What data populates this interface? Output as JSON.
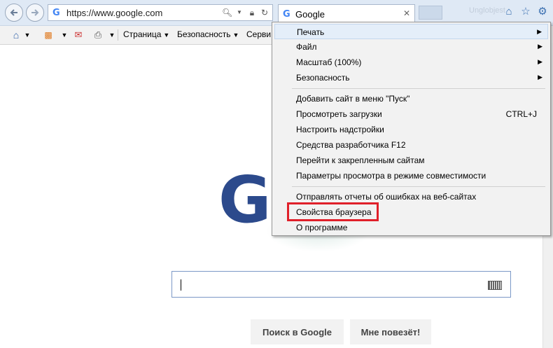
{
  "browser": {
    "address_url": "https://www.google.com",
    "tab_title": "Google",
    "tab_favicon": "G",
    "address_favicon": "G",
    "ghost_label": "Unglobjest"
  },
  "command_bar": {
    "page_label": "Страница",
    "security_label": "Безопасность",
    "service_label": "Серви"
  },
  "menu": {
    "items": [
      {
        "label": "Печать",
        "has_submenu": true
      },
      {
        "label": "Файл",
        "has_submenu": true
      },
      {
        "label": "Масштаб (100%)",
        "has_submenu": true
      },
      {
        "label": "Безопасность",
        "has_submenu": true
      },
      {
        "label": "Добавить сайт в меню \"Пуск\""
      },
      {
        "label": "Просмотреть загрузки",
        "shortcut": "CTRL+J"
      },
      {
        "label": "Настроить надстройки"
      },
      {
        "label": "Средства разработчика F12"
      },
      {
        "label": "Перейти к закрепленным сайтам"
      },
      {
        "label": "Параметры просмотра в режиме совместимости"
      },
      {
        "label": "Отправлять отчеты об ошибках на веб-сайтах"
      },
      {
        "label": "Свойства браузера"
      },
      {
        "label": "О программе"
      }
    ]
  },
  "google": {
    "logo_visible": "G",
    "search_button": "Поиск в Google",
    "lucky_button": "Мне повезёт!"
  },
  "icons": [
    "back-arrow-icon",
    "forward-arrow-icon",
    "search-icon",
    "lock-icon",
    "refresh-icon",
    "close-icon",
    "home-icon",
    "star-icon",
    "gear-icon",
    "rss-icon",
    "mail-icon",
    "print-icon",
    "keyboard-icon"
  ],
  "colors": {
    "highlight_box": "#e0202a",
    "menu_hover": "#e4eef9",
    "google_blue": "#2c4a8c"
  }
}
